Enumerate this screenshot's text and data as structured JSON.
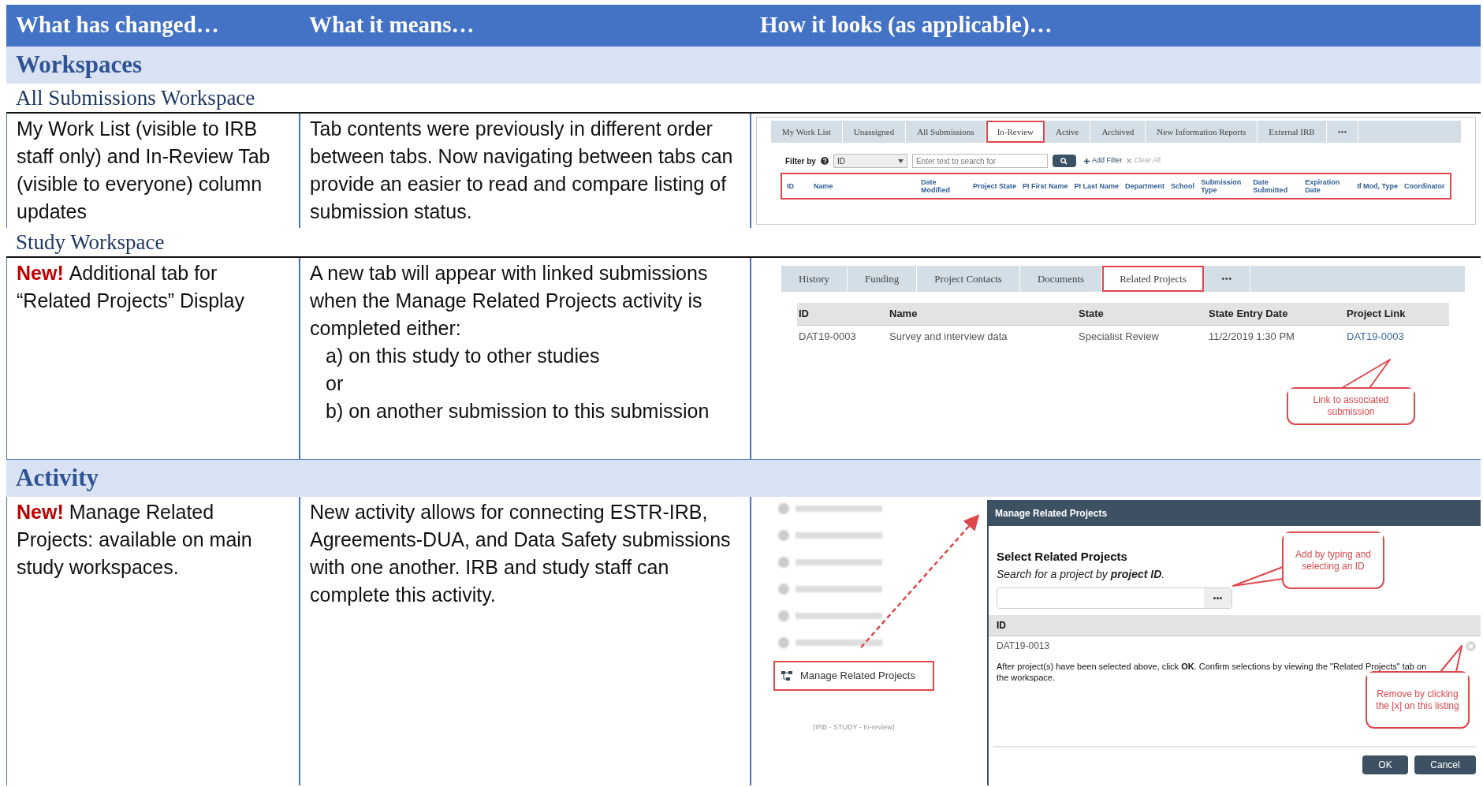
{
  "columns": [
    "What has changed…",
    "What it means…",
    "How it looks (as applicable)…"
  ],
  "rows": [
    {
      "kind": "major",
      "title": "Workspaces"
    },
    {
      "kind": "minor",
      "title": "All Submissions Workspace"
    },
    {
      "kind": "entry",
      "badge": "",
      "change": "My Work List (visible to IRB staff only) and In-Review Tab (visible to everyone) column updates",
      "meaning": [
        "Tab contents were previously in different order between tabs.  Now navigating between tabs can provide an easier to read and compare listing of submission status."
      ],
      "shot": {
        "kind": "worklist",
        "tabs": [
          {
            "label": "My Work List",
            "selected": false
          },
          {
            "label": "Unassigned",
            "selected": false
          },
          {
            "label": "All Submissions",
            "selected": false
          },
          {
            "label": "In-Review",
            "selected": true
          },
          {
            "label": "Active",
            "selected": false
          },
          {
            "label": "Archived",
            "selected": false
          },
          {
            "label": "New Information Reports",
            "selected": false
          },
          {
            "label": "External IRB",
            "selected": false
          },
          {
            "label": "•••",
            "selected": false
          }
        ],
        "filter_label": "Filter by",
        "filter_value": "ID",
        "search_placeholder": "Enter text to search for",
        "add_filter": "Add Filter",
        "clear_all": "Clear All",
        "columns": [
          "ID",
          "Name",
          "Date Modified",
          "Project State",
          "PI First Name",
          "PI Last Name",
          "Department",
          "School",
          "Submission Type",
          "Date Submitted",
          "Expiration Date",
          "If Mod, Type",
          "Coordinator"
        ]
      }
    },
    {
      "kind": "minor",
      "title": "Study Workspace"
    },
    {
      "kind": "entry",
      "badge": "New!",
      "change": "Additional tab for “Related Projects” Display",
      "meaning": [
        "A new tab will appear with linked submissions when the Manage Related Projects activity is completed either:",
        "a) on this study to other studies",
        "or",
        "b) on another submission to this submission"
      ],
      "shot": {
        "kind": "study",
        "tabs": [
          {
            "label": "History",
            "selected": false
          },
          {
            "label": "Funding",
            "selected": false
          },
          {
            "label": "Project Contacts",
            "selected": false
          },
          {
            "label": "Documents",
            "selected": false
          },
          {
            "label": "Related Projects",
            "selected": true
          },
          {
            "label": "•••",
            "selected": false
          }
        ],
        "columns": [
          "ID",
          "Name",
          "State",
          "State Entry Date",
          "Project Link"
        ],
        "row": [
          "DAT19-0003",
          "Survey and interview data",
          "Specialist Review",
          "11/2/2019 1:30 PM",
          "DAT19-0003"
        ],
        "callout": "Link to associated submission"
      }
    },
    {
      "kind": "major",
      "title": "Activity"
    },
    {
      "kind": "entry",
      "badge": "New!",
      "change": "Manage Related Projects: available on main study workspaces.",
      "meaning": [
        "New activity allows for connecting ESTR-IRB, Agreements-DUA, and Data Safety submissions with one another.  IRB and study staff can complete this activity."
      ],
      "shot": {
        "kind": "activity",
        "menu_item": "Manage Related Projects",
        "footer": "(IRB - STUDY - In-review)",
        "dialog_title": "Manage Related Projects",
        "heading": "Select Related Projects",
        "hint": "Search for a project by **project ID**.",
        "id_column": "ID",
        "selected_id": "DAT19-0013",
        "note": "After project(s) have been selected above, click **OK**. Confirm selections by viewing the \"Related Projects\" tab on the workspace.",
        "ok": "OK",
        "cancel": "Cancel",
        "callout_add": "Add by typing and selecting an ID",
        "callout_remove": "Remove by clicking the [x] on this listing"
      }
    }
  ]
}
